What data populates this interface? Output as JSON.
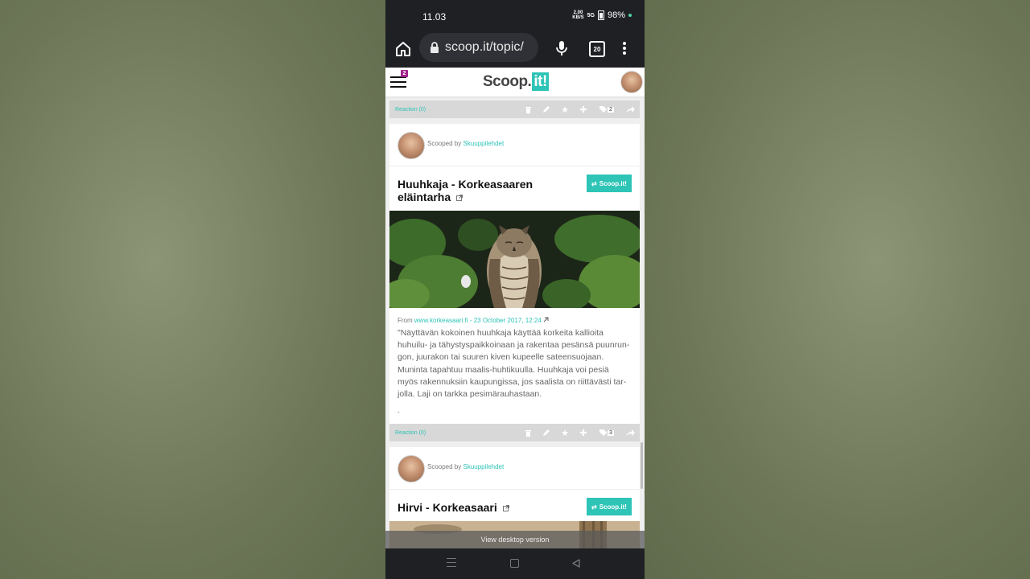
{
  "status_bar": {
    "time": "11.03",
    "net_speed_value": "2.00",
    "net_speed_unit": "KB/S",
    "signal": "5G",
    "battery": "98%"
  },
  "browser": {
    "url": "scoop.it/topic/",
    "tab_count": "20"
  },
  "scoop_header": {
    "notification_count": "2",
    "logo_text": "Scoop.",
    "logo_it": "it!"
  },
  "posts": [
    {
      "reaction_label": "Reaction (0)",
      "tag_count": "2"
    },
    {
      "scooped_prefix": "Scooped by",
      "scooped_user": "Skuuppilehdet",
      "title": "Huuhkaja - Korkeasaaren eläintarha",
      "scoop_button": "Scoop.it!",
      "source_prefix": "From",
      "source_link": "www.korkeasaari.fi - 23 October 2017, 12:24",
      "excerpt": "\"Näyttävän kokoinen huuhkaja käyttää korkeita kallioita huhuilu- ja tähystyspaikkoinaan ja rakentaa pesänsä puunrun­gon, juurakon tai suuren kiven kupeelle sateensuojaan. Muninta tapahtuu maalis-huhtikuulla. Huuhkaja voi pesiä myös rakennuksiin kaupungissa, jos saalista on riittävästi tar­jolla. Laji on tarkka pesimärauhastaan.",
      "dash": "-",
      "reaction_label": "Reaction (0)",
      "tag_count": "3"
    },
    {
      "scooped_prefix": "Scooped by",
      "scooped_user": "Skuuppilehdet",
      "title": "Hirvi - Korkeasaari",
      "scoop_button": "Scoop.it!"
    }
  ],
  "footer": {
    "desktop_link": "View desktop version"
  },
  "colors": {
    "accent": "#2ec4b6",
    "badge": "#a1228b"
  }
}
